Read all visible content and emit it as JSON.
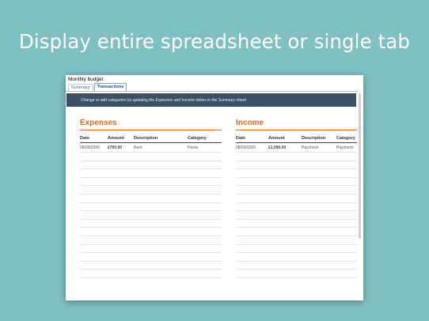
{
  "headline": "Display entire spreadsheet or single tab",
  "workbook": {
    "title": "Monthly budget",
    "tabs": [
      "Summary",
      "Transactions"
    ],
    "active_tab": "Transactions"
  },
  "banner": {
    "text": "Change or add categories by updating the Expenses and Income tables in the Summary sheet."
  },
  "expenses": {
    "title": "Expenses",
    "columns": [
      "Date",
      "Amount",
      "Description",
      "Category"
    ],
    "rows": [
      [
        "08/09/2000",
        "£700.00",
        "Rent",
        "Home"
      ]
    ]
  },
  "income": {
    "title": "Income",
    "columns": [
      "Date",
      "Amount",
      "Description",
      "Category"
    ],
    "rows": [
      [
        "08/09/2000",
        "£1,090.00",
        "Paycheck",
        "Paycheck"
      ]
    ]
  },
  "colors": {
    "background": "#7fc0c0",
    "banner": "#3d4f63",
    "accent": "#e2681f"
  }
}
